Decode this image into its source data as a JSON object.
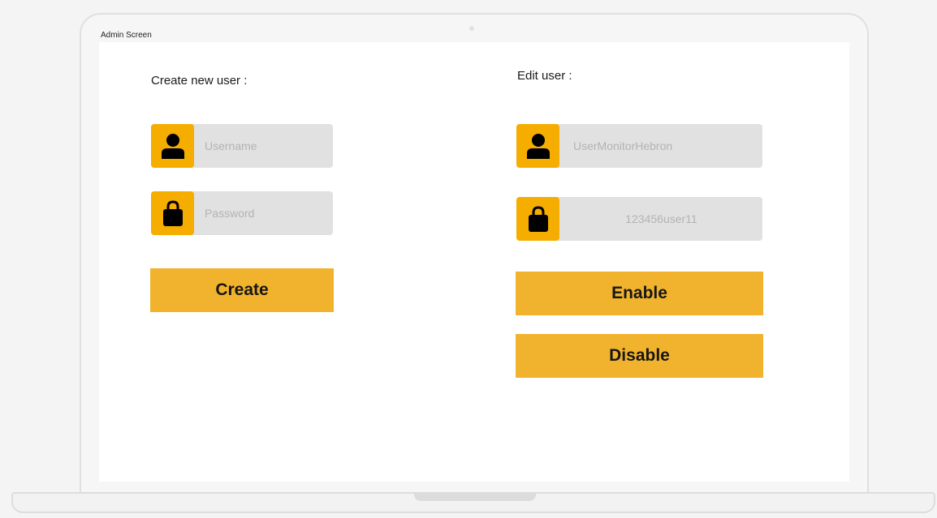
{
  "window": {
    "title": "Admin Screen"
  },
  "create_section": {
    "heading": "Create new user :",
    "username": {
      "icon": "user-icon",
      "placeholder": "Username",
      "value": ""
    },
    "password": {
      "icon": "lock-icon",
      "placeholder": "Password",
      "value": ""
    },
    "create_label": "Create"
  },
  "edit_section": {
    "heading": "Edit user :",
    "username": {
      "icon": "user-icon",
      "value": "UserMonitorHebron"
    },
    "password": {
      "icon": "lock-icon",
      "value": "123456user11"
    },
    "enable_label": "Enable",
    "disable_label": "Disable"
  },
  "colors": {
    "accent": "#f1b32d",
    "icon_bg": "#f5ad00",
    "field_bg": "#e1e1e1",
    "screen_bg": "#ffffff"
  }
}
